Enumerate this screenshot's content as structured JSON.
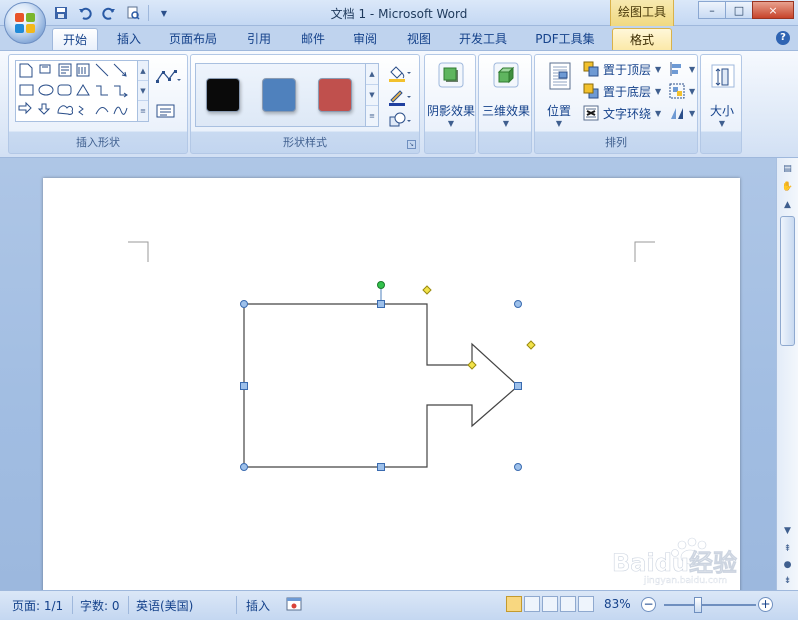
{
  "window": {
    "title": "文档 1 - Microsoft Word",
    "context_tab_label": "绘图工具",
    "controls": {
      "minimize": "–",
      "maximize": "□",
      "close": "×"
    }
  },
  "quick_access": [
    {
      "icon": "save-icon"
    },
    {
      "icon": "undo-icon"
    },
    {
      "icon": "redo-icon"
    },
    {
      "icon": "print-preview-icon"
    },
    {
      "icon": "customize-qat-icon"
    }
  ],
  "tabs": [
    "开始",
    "插入",
    "页面布局",
    "引用",
    "邮件",
    "审阅",
    "视图",
    "开发工具",
    "PDF工具集",
    "格式"
  ],
  "active_tab": "格式",
  "ribbon": {
    "insert_shapes": {
      "label": "插入形状"
    },
    "shape_styles": {
      "label": "形状样式",
      "swatches": [
        "#0a0a0a",
        "#4f81bd",
        "#c0504d"
      ]
    },
    "shadow_effects": {
      "label": "阴影效果"
    },
    "three_d_effects": {
      "label": "三维效果"
    },
    "arrange": {
      "label": "排列",
      "position": "位置",
      "bring_to_front": "置于顶层",
      "send_to_back": "置于底层",
      "text_wrapping": "文字环绕"
    },
    "size": {
      "label": "大小"
    }
  },
  "status_bar": {
    "page": "页面: 1/1",
    "words": "字数: 0",
    "language": "英语(美国)",
    "mode": "插入",
    "zoom": "83%"
  },
  "watermark": {
    "text": "Baidu经验",
    "sub": "jingyan.baidu.com"
  },
  "colors": {
    "accent": "#15428b",
    "selection_handle": "#4f81bd",
    "rotate_handle": "#33c24d",
    "adjust_handle": "#f2e34a"
  }
}
